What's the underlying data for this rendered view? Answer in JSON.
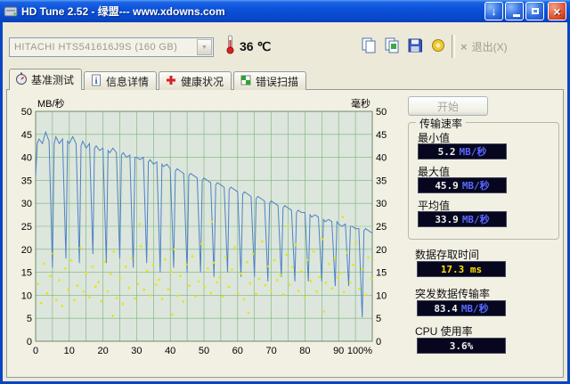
{
  "window": {
    "title": "HD Tune 2.52 - 绿盟--- www.xdowns.com",
    "buttons": {
      "download_glyph": "↓",
      "close_glyph": "×"
    }
  },
  "toolbar": {
    "drive": "HITACHI HTS541616J9S (160 GB)",
    "combo_arrow": "▼",
    "temperature": "36 ℃",
    "exit": "退出(X)",
    "exit_glyph": "×"
  },
  "tabs": {
    "items": [
      {
        "label": "基准测试"
      },
      {
        "label": "信息详情"
      },
      {
        "label": "健康状况"
      },
      {
        "label": "错误扫描"
      }
    ]
  },
  "results": {
    "start_button": "开始",
    "transfer_group": {
      "title": "传输速率",
      "rows": [
        {
          "label": "最小值",
          "value": "5.2",
          "unit": "MB/秒"
        },
        {
          "label": "最大值",
          "value": "45.9",
          "unit": "MB/秒"
        },
        {
          "label": "平均值",
          "value": "33.9",
          "unit": "MB/秒"
        }
      ]
    },
    "access_time": {
      "label": "数据存取时间",
      "value": "17.3 ms"
    },
    "burst_rate": {
      "label": "突发数据传输率",
      "value": "83.4",
      "unit": "MB/秒"
    },
    "cpu_usage": {
      "label": "CPU 使用率",
      "value": "3.6%"
    }
  },
  "colors": {
    "titlebar_blue": "#0846c6",
    "value_unit_blue": "#5868ff",
    "access_yellow": "#ffe000"
  },
  "chart_data": {
    "type": "line+scatter",
    "title": "",
    "x_axis": {
      "label": "",
      "min": 0,
      "max": 100,
      "tick_step": 10,
      "ticks": [
        "0",
        "10",
        "20",
        "30",
        "40",
        "50",
        "60",
        "70",
        "80",
        "90",
        "100%"
      ]
    },
    "y_left": {
      "label": "MB/秒",
      "min": 0,
      "max": 50,
      "tick_step": 5
    },
    "y_right": {
      "label": "毫秒",
      "min": 0,
      "max": 50,
      "tick_step": 5
    },
    "grid": {
      "x_step": 5,
      "y_step": 5
    },
    "colors": {
      "plot_bg": "#dce6dc",
      "grid": "#79b279",
      "border": "#6a8c6a"
    },
    "series": [
      {
        "name": "传输速率",
        "type": "line",
        "color": "#4f81c7",
        "points": [
          [
            0,
            36
          ],
          [
            0.5,
            43
          ],
          [
            1,
            44
          ],
          [
            2,
            43
          ],
          [
            3,
            45.5
          ],
          [
            4,
            43.5
          ],
          [
            5,
            16
          ],
          [
            5.5,
            43
          ],
          [
            6,
            44.5
          ],
          [
            7,
            43
          ],
          [
            8,
            44
          ],
          [
            9,
            18
          ],
          [
            9.5,
            43.5
          ],
          [
            10,
            43
          ],
          [
            11,
            44.5
          ],
          [
            12,
            43
          ],
          [
            13,
            17
          ],
          [
            13.5,
            42.5
          ],
          [
            14,
            43.5
          ],
          [
            15,
            42
          ],
          [
            16,
            43
          ],
          [
            17,
            19
          ],
          [
            17.5,
            42
          ],
          [
            18,
            42.5
          ],
          [
            19,
            41.5
          ],
          [
            20,
            42
          ],
          [
            21,
            17
          ],
          [
            21.5,
            41.5
          ],
          [
            22,
            41
          ],
          [
            23,
            42
          ],
          [
            24,
            41
          ],
          [
            25,
            18
          ],
          [
            25.5,
            40.5
          ],
          [
            26,
            41
          ],
          [
            27,
            40
          ],
          [
            28,
            40.5
          ],
          [
            29,
            16
          ],
          [
            29.5,
            40
          ],
          [
            30,
            40
          ],
          [
            31,
            39.5
          ],
          [
            32,
            40
          ],
          [
            33,
            17
          ],
          [
            33.5,
            39
          ],
          [
            34,
            39.5
          ],
          [
            35,
            38.5
          ],
          [
            36,
            39
          ],
          [
            37,
            15
          ],
          [
            37.5,
            38.5
          ],
          [
            38,
            38
          ],
          [
            39,
            38.5
          ],
          [
            40,
            37.5
          ],
          [
            41,
            16
          ],
          [
            41.5,
            37
          ],
          [
            42,
            37.5
          ],
          [
            43,
            37
          ],
          [
            44,
            36.5
          ],
          [
            45,
            15
          ],
          [
            45.5,
            36
          ],
          [
            46,
            36.5
          ],
          [
            47,
            36
          ],
          [
            48,
            35.5
          ],
          [
            49,
            15
          ],
          [
            49.5,
            35
          ],
          [
            50,
            35.5
          ],
          [
            51,
            35
          ],
          [
            52,
            34.5
          ],
          [
            53,
            14
          ],
          [
            53.5,
            34
          ],
          [
            54,
            34.5
          ],
          [
            55,
            34
          ],
          [
            56,
            33.5
          ],
          [
            57,
            15
          ],
          [
            57.5,
            33
          ],
          [
            58,
            33.5
          ],
          [
            59,
            33
          ],
          [
            60,
            32.5
          ],
          [
            61,
            14
          ],
          [
            61.5,
            32
          ],
          [
            62,
            32.5
          ],
          [
            63,
            32
          ],
          [
            64,
            31.5
          ],
          [
            65,
            14
          ],
          [
            65.5,
            31
          ],
          [
            66,
            31.5
          ],
          [
            67,
            31
          ],
          [
            68,
            30.5
          ],
          [
            69,
            13
          ],
          [
            69.5,
            30
          ],
          [
            70,
            30.5
          ],
          [
            71,
            30
          ],
          [
            72,
            29.5
          ],
          [
            73,
            14
          ],
          [
            73.5,
            29
          ],
          [
            74,
            29.5
          ],
          [
            75,
            29
          ],
          [
            76,
            28.5
          ],
          [
            77,
            13
          ],
          [
            77.5,
            28
          ],
          [
            78,
            28.5
          ],
          [
            79,
            28
          ],
          [
            80,
            28
          ],
          [
            81,
            13
          ],
          [
            81.5,
            27.5
          ],
          [
            82,
            27
          ],
          [
            83,
            27.5
          ],
          [
            84,
            27
          ],
          [
            85,
            13
          ],
          [
            85.5,
            26.5
          ],
          [
            86,
            26
          ],
          [
            87,
            26.5
          ],
          [
            88,
            26
          ],
          [
            89,
            12
          ],
          [
            89.5,
            26
          ],
          [
            90,
            25.5
          ],
          [
            91,
            25
          ],
          [
            92,
            25.5
          ],
          [
            93,
            12
          ],
          [
            93.5,
            25
          ],
          [
            94,
            25
          ],
          [
            95,
            24.5
          ],
          [
            96,
            24.5
          ],
          [
            97,
            5.2
          ],
          [
            97.5,
            24
          ],
          [
            98,
            24.5
          ],
          [
            99,
            24
          ],
          [
            100,
            23.5
          ]
        ]
      },
      {
        "name": "存取时间",
        "type": "scatter",
        "color": "#e6e600",
        "points": [
          [
            0.7,
            12.5
          ],
          [
            1.6,
            8.3
          ],
          [
            2.5,
            16.9
          ],
          [
            3.4,
            10.4
          ],
          [
            4.3,
            14.2
          ],
          [
            5.2,
            19.1
          ],
          [
            6.1,
            9.0
          ],
          [
            7.0,
            13.3
          ],
          [
            7.9,
            7.7
          ],
          [
            8.8,
            15.8
          ],
          [
            9.7,
            11.2
          ],
          [
            10.6,
            17.6
          ],
          [
            11.5,
            8.9
          ],
          [
            12.4,
            12.1
          ],
          [
            13.3,
            20.3
          ],
          [
            14.2,
            10.8
          ],
          [
            15.1,
            14.9
          ],
          [
            16.0,
            9.6
          ],
          [
            16.9,
            16.2
          ],
          [
            17.8,
            11.9
          ],
          [
            18.7,
            12.9
          ],
          [
            19.6,
            8.7
          ],
          [
            20.5,
            17.3
          ],
          [
            21.4,
            10.8
          ],
          [
            22.3,
            14.6
          ],
          [
            23.2,
            19.5
          ],
          [
            24.1,
            9.4
          ],
          [
            25.0,
            13.7
          ],
          [
            25.9,
            8.1
          ],
          [
            26.8,
            16.2
          ],
          [
            27.7,
            11.6
          ],
          [
            28.6,
            18.0
          ],
          [
            29.5,
            9.3
          ],
          [
            30.4,
            12.5
          ],
          [
            31.3,
            20.7
          ],
          [
            32.2,
            11.2
          ],
          [
            33.1,
            15.3
          ],
          [
            34.0,
            10.0
          ],
          [
            34.9,
            16.6
          ],
          [
            35.8,
            12.3
          ],
          [
            36.7,
            13.4
          ],
          [
            37.6,
            9.2
          ],
          [
            38.5,
            17.8
          ],
          [
            39.4,
            11.3
          ],
          [
            40.3,
            15.1
          ],
          [
            41.2,
            20.0
          ],
          [
            42.1,
            9.9
          ],
          [
            43.0,
            14.2
          ],
          [
            43.9,
            8.6
          ],
          [
            44.8,
            16.7
          ],
          [
            45.7,
            12.1
          ],
          [
            46.6,
            18.5
          ],
          [
            47.5,
            9.8
          ],
          [
            48.4,
            13.0
          ],
          [
            49.3,
            21.2
          ],
          [
            50.2,
            11.7
          ],
          [
            51.1,
            15.8
          ],
          [
            52.0,
            10.5
          ],
          [
            52.9,
            17.1
          ],
          [
            53.8,
            12.8
          ],
          [
            54.7,
            13.9
          ],
          [
            55.6,
            9.7
          ],
          [
            56.5,
            18.3
          ],
          [
            57.4,
            11.8
          ],
          [
            58.3,
            15.6
          ],
          [
            59.2,
            20.5
          ],
          [
            60.1,
            10.4
          ],
          [
            61.0,
            14.7
          ],
          [
            61.9,
            9.1
          ],
          [
            62.8,
            17.2
          ],
          [
            63.7,
            12.6
          ],
          [
            64.6,
            19.0
          ],
          [
            65.5,
            10.3
          ],
          [
            66.4,
            13.5
          ],
          [
            67.3,
            21.7
          ],
          [
            68.2,
            12.2
          ],
          [
            69.1,
            16.3
          ],
          [
            70.0,
            11.0
          ],
          [
            70.9,
            17.6
          ],
          [
            71.8,
            13.3
          ],
          [
            72.7,
            14.4
          ],
          [
            73.6,
            10.2
          ],
          [
            74.5,
            18.8
          ],
          [
            75.4,
            12.3
          ],
          [
            76.3,
            16.1
          ],
          [
            77.2,
            21.0
          ],
          [
            78.1,
            10.9
          ],
          [
            79.0,
            15.2
          ],
          [
            79.9,
            9.6
          ],
          [
            80.8,
            17.7
          ],
          [
            81.7,
            13.1
          ],
          [
            82.6,
            19.5
          ],
          [
            83.5,
            10.8
          ],
          [
            84.4,
            14.0
          ],
          [
            85.3,
            22.2
          ],
          [
            86.2,
            12.7
          ],
          [
            87.1,
            16.8
          ],
          [
            88.0,
            11.5
          ],
          [
            88.9,
            18.1
          ],
          [
            89.8,
            13.8
          ],
          [
            90.7,
            14.9
          ],
          [
            91.6,
            10.7
          ],
          [
            92.5,
            19.3
          ],
          [
            93.4,
            12.8
          ],
          [
            94.3,
            16.6
          ],
          [
            95.2,
            21.5
          ],
          [
            96.1,
            11.4
          ],
          [
            97.0,
            15.7
          ],
          [
            97.9,
            10.1
          ],
          [
            98.8,
            18.2
          ],
          [
            99.7,
            13.6
          ],
          [
            30.9,
            25.5
          ],
          [
            52.3,
            26.0
          ],
          [
            74.9,
            25.0
          ],
          [
            91.2,
            27.0
          ],
          [
            40.7,
            5.8
          ],
          [
            63.2,
            6.2
          ],
          [
            85.7,
            6.5
          ],
          [
            22.9,
            5.5
          ]
        ]
      }
    ]
  }
}
